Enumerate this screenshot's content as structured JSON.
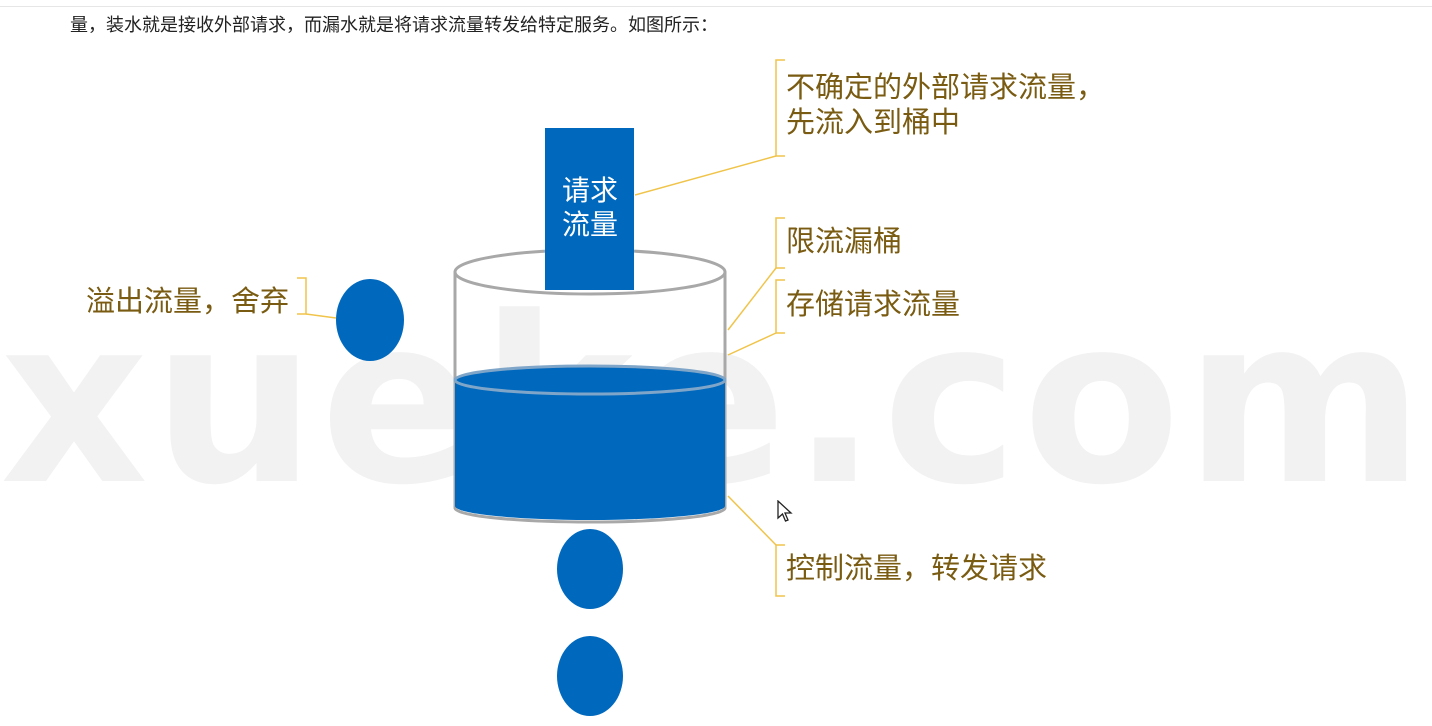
{
  "caption": "量，装水就是接收外部请求，而漏水就是将请求流量转发给特定服务。如图所示：",
  "watermark": "xueke.com",
  "request_box": {
    "line1": "请求",
    "line2": "流量"
  },
  "labels": {
    "incoming_line1": "不确定的外部请求流量，",
    "incoming_line2": "先流入到桶中",
    "bucket": "限流漏桶",
    "storage": "存储请求流量",
    "overflow": "溢出流量，舍弃",
    "output": "控制流量，转发请求"
  },
  "colors": {
    "water_blue": "#0068bd",
    "label_brown": "#7a5b12",
    "bracket_yellow": "#f0c44a",
    "bucket_outline": "#a8a8a8"
  }
}
